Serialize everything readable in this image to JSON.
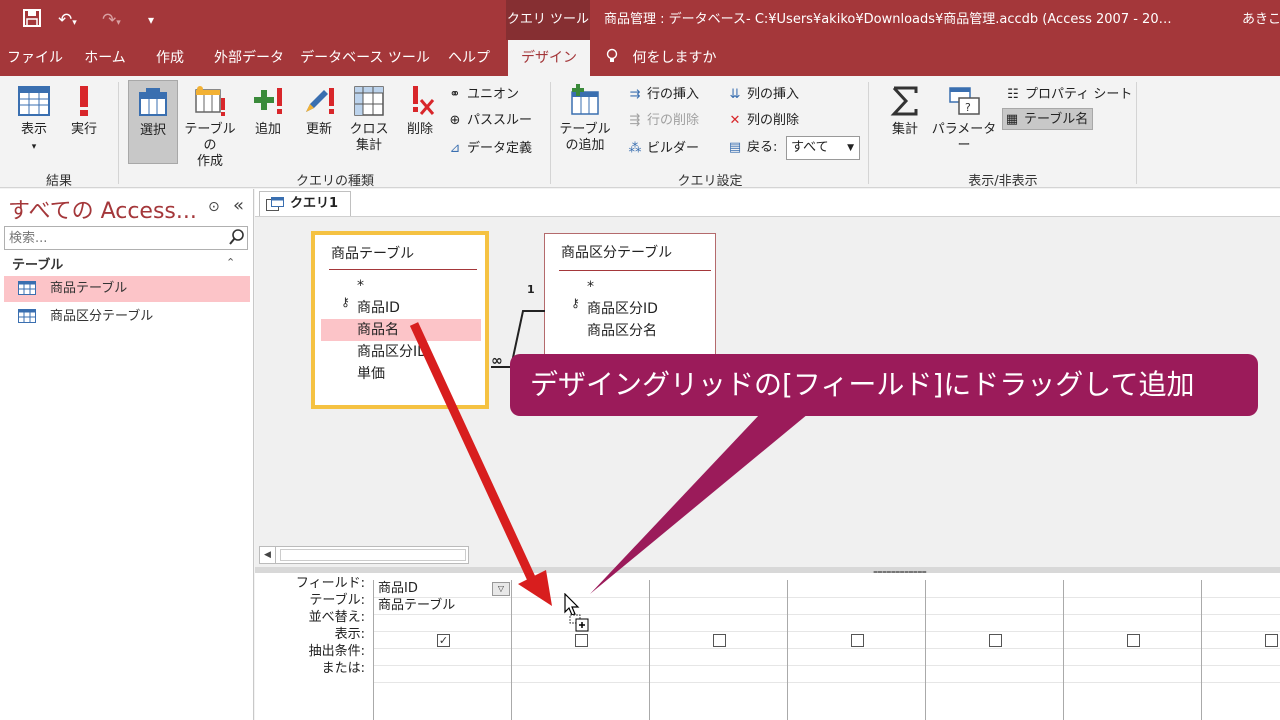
{
  "titlebar": {
    "context_tab": "クエリ ツール",
    "window_title": "商品管理 : データベース- C:¥Users¥akiko¥Downloads¥商品管理.accdb (Access 2007 - 20…",
    "user": "あきこ"
  },
  "ribbon_tabs": [
    {
      "label": "ファイル"
    },
    {
      "label": "ホーム"
    },
    {
      "label": "作成"
    },
    {
      "label": "外部データ"
    },
    {
      "label": "データベース ツール"
    },
    {
      "label": "ヘルプ"
    },
    {
      "label": "デザイン"
    }
  ],
  "tell_me": "何をしますか",
  "ribbon": {
    "results": {
      "label": "結果",
      "view": "表示",
      "run": "実行"
    },
    "query_type": {
      "label": "クエリの種類",
      "select": "選択",
      "make_table_1": "テーブルの",
      "make_table_2": "作成",
      "append": "追加",
      "update": "更新",
      "crosstab_1": "クロス",
      "crosstab_2": "集計",
      "delete": "削除",
      "union": "ユニオン",
      "passthrough": "パススルー",
      "data_definition": "データ定義"
    },
    "query_setup": {
      "label": "クエリ設定",
      "show_table_1": "テーブル",
      "show_table_2": "の追加",
      "insert_rows": "行の挿入",
      "delete_rows": "行の削除",
      "builder": "ビルダー",
      "insert_columns": "列の挿入",
      "delete_columns": "列の削除",
      "return": "戻る:",
      "return_value": "すべて"
    },
    "show_hide": {
      "label": "表示/非表示",
      "totals": "集計",
      "parameters": "パラメーター",
      "property_sheet": "プロパティ シート",
      "table_names": "テーブル名"
    }
  },
  "nav": {
    "title": "すべての Access...",
    "search_placeholder": "検索...",
    "group": "テーブル",
    "items": [
      {
        "label": "商品テーブル"
      },
      {
        "label": "商品区分テーブル"
      }
    ]
  },
  "doc_tab": "クエリ1",
  "field_lists": [
    {
      "title": "商品テーブル",
      "fields": [
        "*",
        "商品ID",
        "商品名",
        "商品区分ID",
        "単価"
      ]
    },
    {
      "title": "商品区分テーブル",
      "fields": [
        "*",
        "商品区分ID",
        "商品区分名"
      ]
    }
  ],
  "relationship": {
    "one": "1",
    "many": "∞"
  },
  "grid": {
    "row_labels": [
      "フィールド:",
      "テーブル:",
      "並べ替え:",
      "表示:",
      "抽出条件:",
      "または:"
    ],
    "col1_field": "商品ID",
    "col1_table": "商品テーブル"
  },
  "callout_text": "デザイングリッドの[フィールド]にドラッグして追加",
  "colors": {
    "access_red": "#a4373a",
    "callout": "#9b1b5a",
    "arrow": "#d81e1e",
    "selection": "#fcc4c8",
    "table_focus": "#f5c242"
  }
}
